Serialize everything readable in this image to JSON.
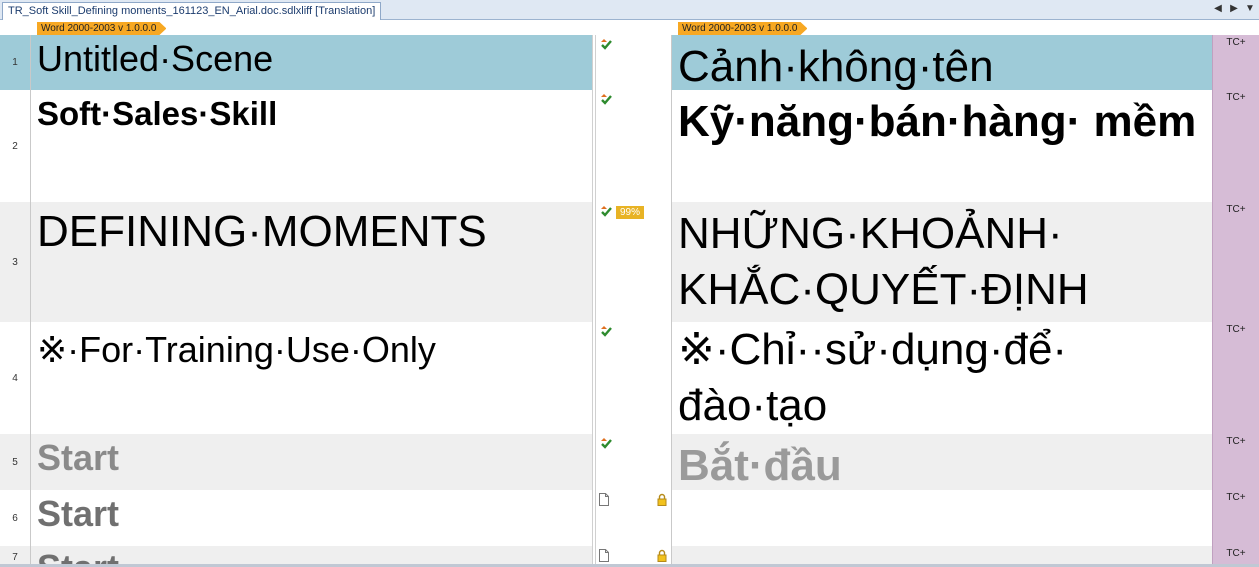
{
  "tab": {
    "title": "TR_Soft Skill_Defining moments_161123_EN_Arial.doc.sdlxliff [Translation]"
  },
  "file_tag": {
    "source": "Word 2000-2003 v 1.0.0.0",
    "target": "Word 2000-2003 v 1.0.0.0"
  },
  "segments": [
    {
      "num": "1",
      "source": "Untitled·Scene",
      "target": "Cảnh·không·tên",
      "status": "confirmed",
      "match": "",
      "tc": "TC+"
    },
    {
      "num": "2",
      "source": "Soft·Sales·Skill",
      "target": "Kỹ·năng·bán·hàng· mềm",
      "status": "confirmed",
      "match": "",
      "tc": "TC+"
    },
    {
      "num": "3",
      "source": "DEFINING·MOMENTS",
      "target": "NHỮNG·KHOẢNH· KHẮC·QUYẾT·ĐỊNH",
      "status": "confirmed",
      "match": "99%",
      "tc": "TC+"
    },
    {
      "num": "4",
      "source": "※·For·Training·Use·Only",
      "target": "※·Chỉ··sử·dụng·để· đào·tạo",
      "status": "confirmed",
      "match": "",
      "tc": "TC+"
    },
    {
      "num": "5",
      "source": "Start",
      "target": "Bắt·đầu",
      "status": "confirmed",
      "match": "",
      "tc": "TC+"
    },
    {
      "num": "6",
      "source": "Start",
      "target": "",
      "status": "locked",
      "match": "",
      "tc": "TC+"
    },
    {
      "num": "7",
      "source": "Start",
      "target": "",
      "status": "locked",
      "match": "",
      "tc": "TC+"
    }
  ]
}
